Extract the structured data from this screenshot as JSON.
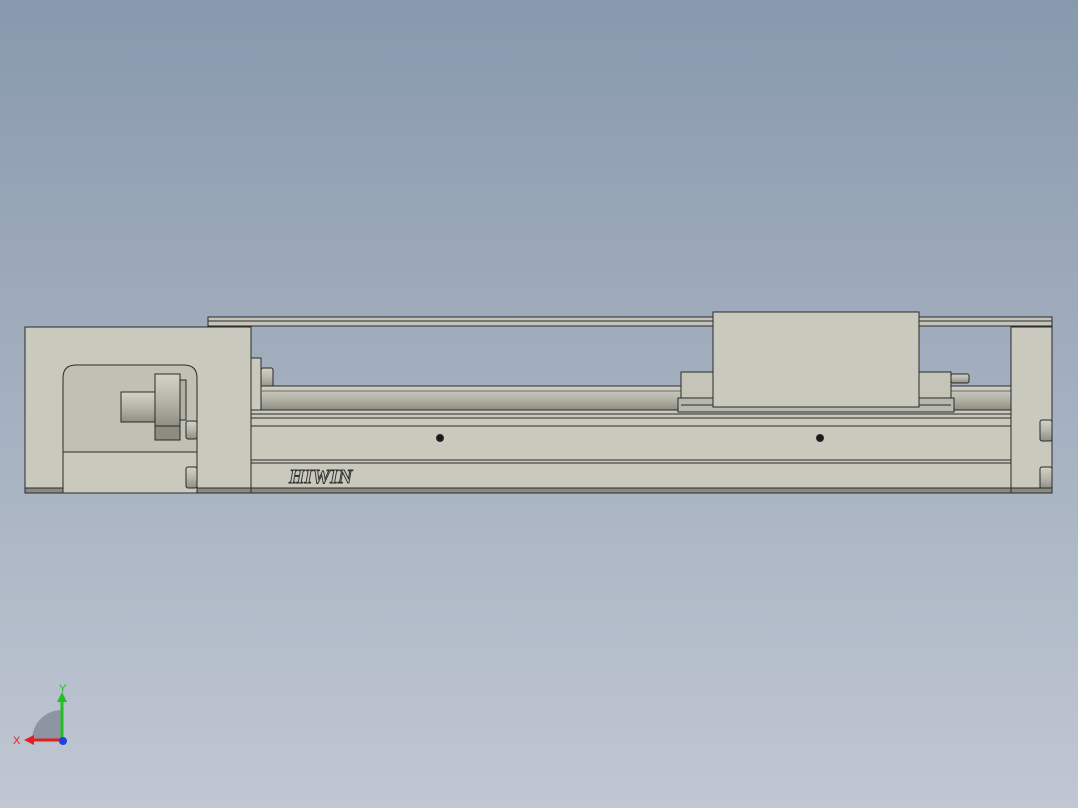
{
  "viewport": {
    "background_top": "#8899ad",
    "background_bottom": "#c0c7d2"
  },
  "model": {
    "brand_text": "HIWIN",
    "body_color": "#c9c9bd",
    "edge_color": "#2a2a2a",
    "shade_color": "#a9a99d"
  },
  "triad": {
    "x_label": "X",
    "y_label": "Y",
    "x_color": "#e02020",
    "y_color": "#20c020",
    "z_color": "#2040e0"
  }
}
